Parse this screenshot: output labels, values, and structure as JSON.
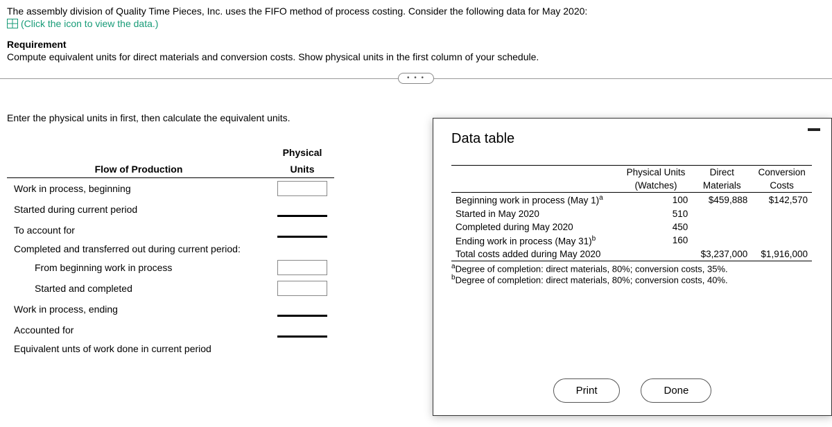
{
  "intro_line": "The assembly division of Quality Time Pieces, Inc. uses the FIFO method of process costing. Consider the following data for May 2020:",
  "click_text": "(Click the icon to view the data.)",
  "requirement_label": "Requirement",
  "requirement_text": "Compute equivalent units for direct materials and conversion costs. Show physical units in the first column of your schedule.",
  "enter_hint": "Enter the physical units in first, then calculate the equivalent units.",
  "prod_table": {
    "flow_header": "Flow of Production",
    "phys_header_1": "Physical",
    "phys_header_2": "Units",
    "rows": {
      "r1": "Work in process, beginning",
      "r2": "Started during current period",
      "r3": "To account for",
      "r4": "Completed and transferred out during current period:",
      "r5": "From beginning work in process",
      "r6": "Started and completed",
      "r7": "Work in process, ending",
      "r8": "Accounted for",
      "r9": "Equivalent unts of work done in current period"
    }
  },
  "modal": {
    "title": "Data table",
    "headers": {
      "phys1": "Physical Units",
      "phys2": "(Watches)",
      "dir1": "Direct",
      "dir2": "Materials",
      "conv1": "Conversion",
      "conv2": "Costs"
    },
    "rows": {
      "begin_label": "Beginning work in process (May 1)",
      "begin_sup": "a",
      "begin_units": "100",
      "begin_dm": "$459,888",
      "begin_cc": "$142,570",
      "started_label": "Started in May 2020",
      "started_units": "510",
      "completed_label": "Completed during May 2020",
      "completed_units": "450",
      "ending_label": "Ending work in process (May 31)",
      "ending_sup": "b",
      "ending_units": "160",
      "total_label": "Total costs added during May 2020",
      "total_dm": "$3,237,000",
      "total_cc": "$1,916,000"
    },
    "footnote_a": "Degree of completion: direct materials, 80%; conversion costs, 35%.",
    "footnote_b": "Degree of completion: direct materials, 80%; conversion costs, 40%.",
    "print_label": "Print",
    "done_label": "Done"
  }
}
